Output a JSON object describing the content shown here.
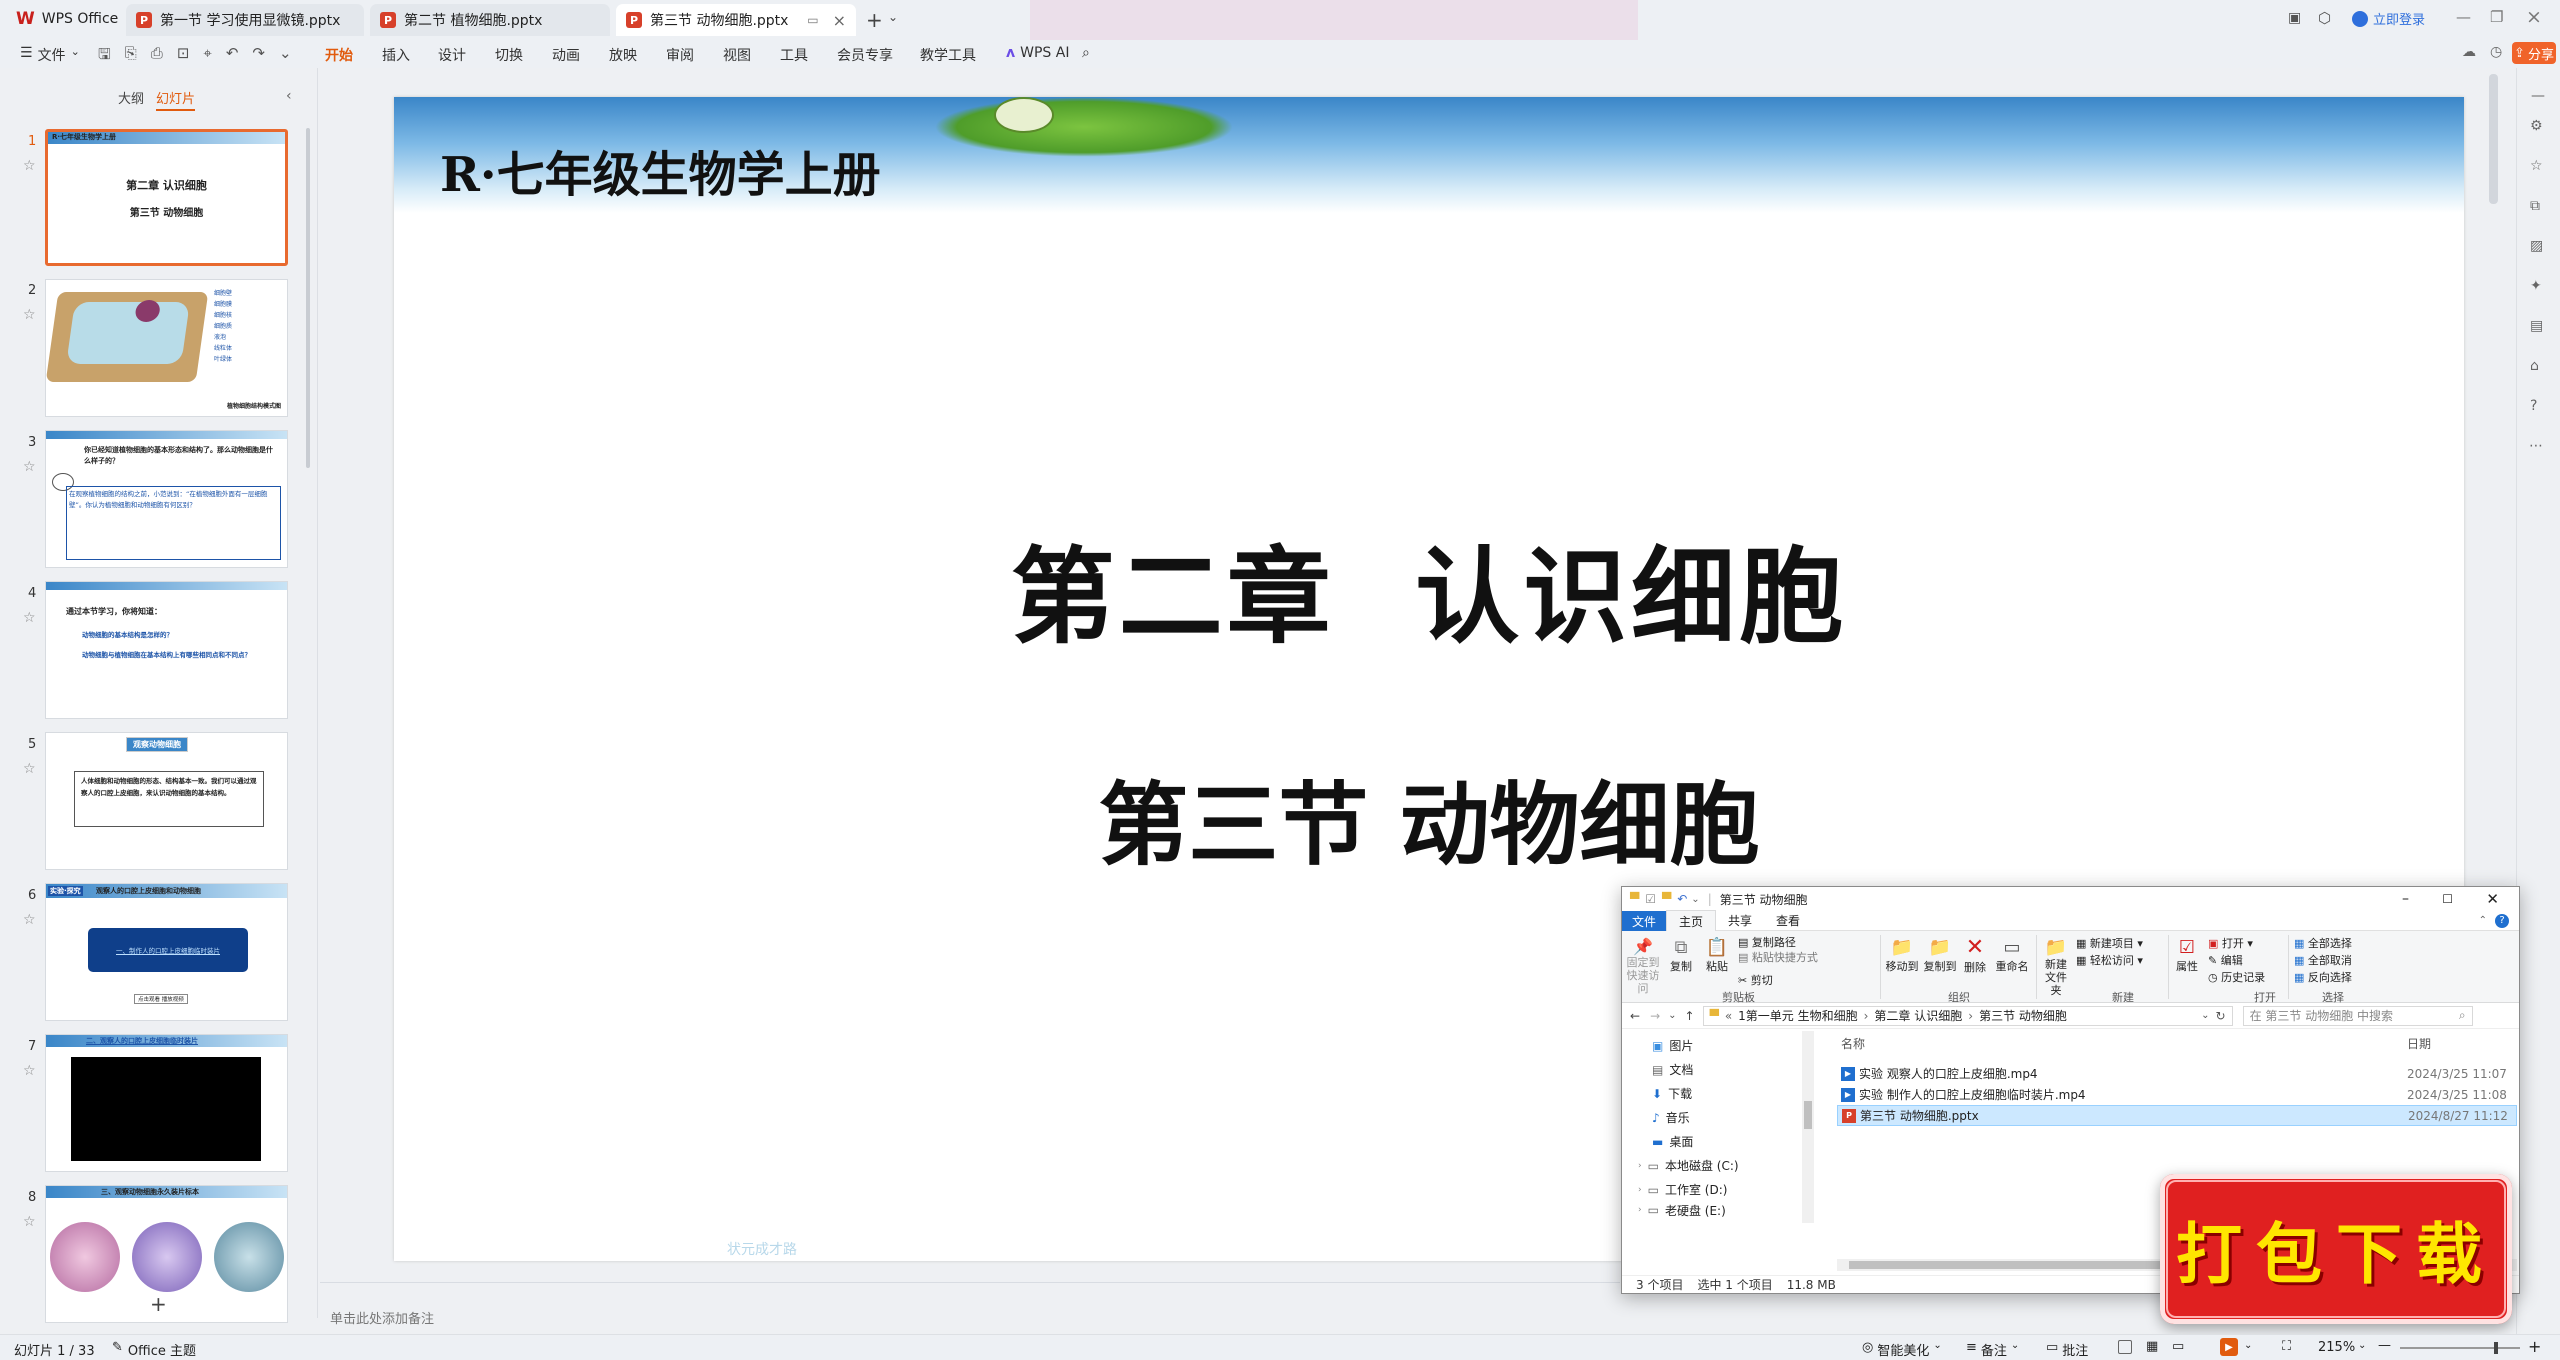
{
  "titlebar": {
    "app_name": "WPS Office",
    "tabs": [
      {
        "label": "第一节 学习使用显微镜.pptx"
      },
      {
        "label": "第二节 植物细胞.pptx"
      },
      {
        "label": "第三节 动物细胞.pptx"
      }
    ],
    "login": "立即登录"
  },
  "menubar": {
    "file": "文件",
    "items": [
      "开始",
      "插入",
      "设计",
      "切换",
      "动画",
      "放映",
      "审阅",
      "视图",
      "工具",
      "会员专享",
      "教学工具"
    ],
    "wps_ai": "WPS AI",
    "share": "分享"
  },
  "leftpanel": {
    "tab_outline": "大纲",
    "tab_slides": "幻灯片",
    "slides": [
      {
        "num": "1",
        "t1": "第二章 认识细胞",
        "t2": "第三节 动物细胞",
        "header": "R·七年级生物学上册"
      },
      {
        "num": "2",
        "caption": "植物细胞结构模式图",
        "labels": [
          "细胞壁",
          "细胞膜",
          "细胞核",
          "细胞质",
          "液泡",
          "线粒体",
          "叶绿体"
        ]
      },
      {
        "num": "3",
        "q": "你已经知道植物细胞的基本形态和结构了。那么动物细胞是什么样子的？",
        "body": "在观察植物细胞的结构之前，小范说到：“在植物细胞外面有一层细胞壁”。你认为植物细胞和动物细胞有何区别？"
      },
      {
        "num": "4",
        "title": "通过本节学习，你将知道：",
        "b1": "动物细胞的基本结构是怎样的？",
        "b2": "动物细胞与植物细胞在基本结构上有哪些相同点和不同点？"
      },
      {
        "num": "5",
        "title": "观察动物细胞",
        "body": "人体细胞和动物细胞的形态、结构基本一致。我们可以通过观察人的口腔上皮细胞，来认识动物细胞的基本结构。"
      },
      {
        "num": "6",
        "tag": "实验·探究",
        "title": "观察人的口腔上皮细胞和动物细胞",
        "btn": "一、制作人的口腔上皮细胞临时装片",
        "small": "点击观看 播放视频"
      },
      {
        "num": "7",
        "title": "二、观察人的口腔上皮细胞临时装片"
      },
      {
        "num": "8",
        "title": "三、观察动物细胞永久装片标本"
      }
    ]
  },
  "slide": {
    "header": "R·七年级生物学上册",
    "title": "第二章  认识细胞",
    "subtitle": "第三节 动物细胞",
    "watermark": "状元成才路",
    "notes_placeholder": "单击此处添加备注"
  },
  "explorer": {
    "title": "第三节 动物细胞",
    "tabs": [
      "文件",
      "主页",
      "共享",
      "查看"
    ],
    "ribbon": {
      "pin": "固定到快速访问",
      "copy": "复制",
      "paste": "粘贴",
      "copy_path": "复制路径",
      "paste_shortcut": "粘贴快捷方式",
      "cut": "剪切",
      "g_clipboard": "剪贴板",
      "move_to": "移动到",
      "copy_to": "复制到",
      "delete": "删除",
      "rename": "重命名",
      "g_organize": "组织",
      "new_folder": "新建文件夹",
      "new_item": "新建项目",
      "easy_access": "轻松访问",
      "g_new": "新建",
      "properties": "属性",
      "open": "打开",
      "edit": "编辑",
      "history": "历史记录",
      "g_open": "打开",
      "select_all": "全部选择",
      "select_none": "全部取消",
      "invert": "反向选择",
      "g_select": "选择"
    },
    "path": [
      "1第一单元 生物和细胞",
      "第二章 认识细胞",
      "第三节 动物细胞"
    ],
    "search_placeholder": "在 第三节 动物细胞 中搜索",
    "nav": [
      "图片",
      "文档",
      "下载",
      "音乐",
      "桌面",
      "本地磁盘 (C:)",
      "工作室 (D:)",
      "老硬盘 (E:)"
    ],
    "col_name": "名称",
    "col_date": "日期",
    "files": [
      {
        "name": "实验 观察人的口腔上皮细胞.mp4",
        "date": "2024/3/25 11:07"
      },
      {
        "name": "实验 制作人的口腔上皮细胞临时装片.mp4",
        "date": "2024/3/25 11:08"
      },
      {
        "name": "第三节 动物细胞.pptx",
        "date": "2024/8/27 11:12"
      }
    ],
    "status_count": "3 个项目",
    "status_sel": "选中 1 个项目",
    "status_size": "11.8 MB"
  },
  "promo": {
    "text": "打包下载"
  },
  "statusbar": {
    "slide_counter": "幻灯片 1 / 33",
    "theme": "Office 主题",
    "beautify": "智能美化",
    "notes": "备注",
    "comments": "批注",
    "zoom": "215%"
  }
}
